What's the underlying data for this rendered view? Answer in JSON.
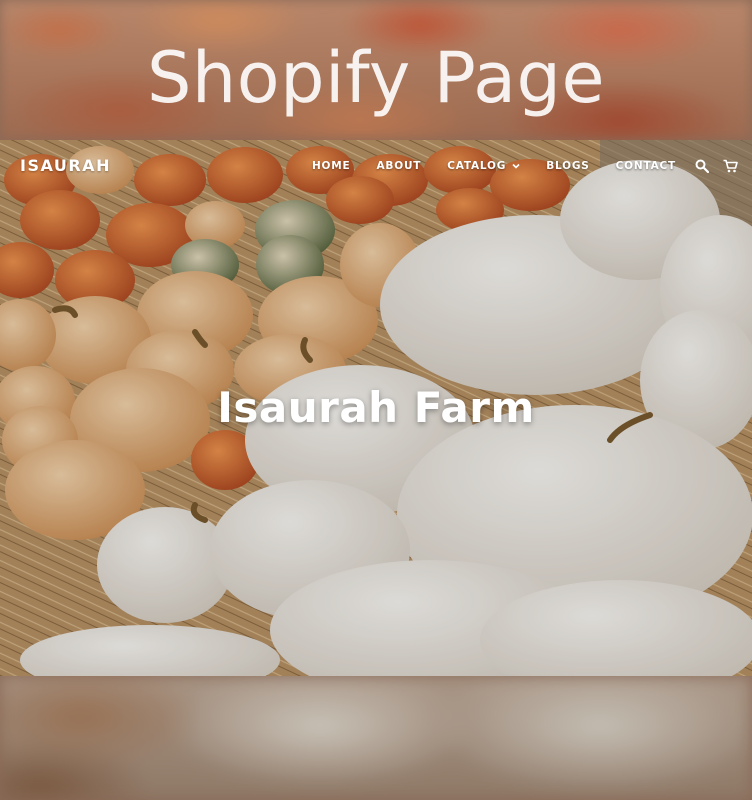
{
  "page": {
    "title": "Shopify Page"
  },
  "header": {
    "logo": "ISAURAH",
    "nav": [
      {
        "label": "HOME"
      },
      {
        "label": "ABOUT"
      },
      {
        "label": "CATALOG",
        "has_dropdown": true
      },
      {
        "label": "BLOGS"
      },
      {
        "label": "CONTACT"
      }
    ],
    "icons": [
      "search-icon",
      "cart-icon"
    ]
  },
  "hero": {
    "heading": "Isaurah Farm"
  },
  "colors": {
    "nav_text": "#ffffff",
    "title_text": "#ffffff"
  }
}
